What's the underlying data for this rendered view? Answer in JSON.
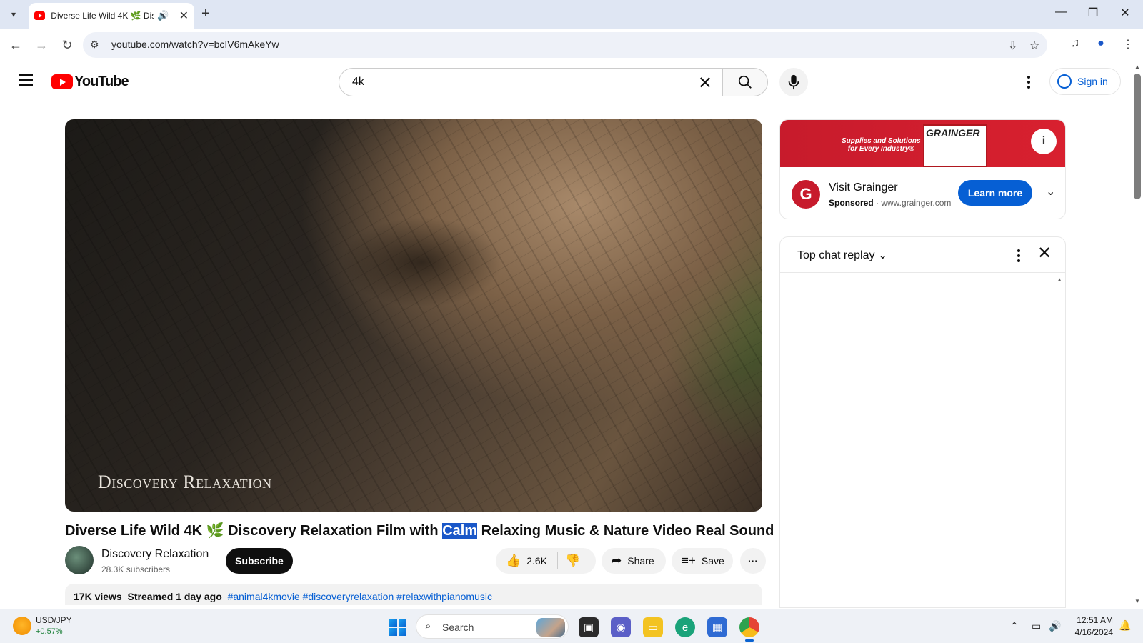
{
  "browser": {
    "tab_title": "Diverse Life Wild 4K 🌿 Dis",
    "url": "youtube.com/watch?v=bcIV6mAkeYw"
  },
  "youtube": {
    "logo_text": "YouTube",
    "search_value": "4k",
    "signin_label": "Sign in"
  },
  "video": {
    "watermark": "Discovery Relaxation",
    "title_before": "Diverse Life Wild 4K 🌿 Discovery Relaxation Film with ",
    "title_highlight": "Calm",
    "title_after": " Relaxing Music & Nature Video Real Sound",
    "channel_name": "Discovery Relaxation",
    "subscribers": "28.3K subscribers",
    "subscribe_label": "Subscribe",
    "likes": "2.6K",
    "share_label": "Share",
    "save_label": "Save",
    "views": "17K views",
    "streamed": "Streamed 1 day ago",
    "hashtags": "#animal4kmovie #discoveryrelaxation #relaxwithpianomusic"
  },
  "ad": {
    "banner_tagline_1": "Supplies and Solutions",
    "banner_tagline_2": "for Every Industry®",
    "banner_brand": "GRAINGER",
    "name": "Visit Grainger",
    "sponsored": "Sponsored",
    "domain": "· www.grainger.com",
    "cta": "Learn more"
  },
  "chat": {
    "title": "Top chat replay"
  },
  "taskbar": {
    "ticker": "USD/JPY",
    "ticker_change": "+0.57%",
    "search_label": "Search",
    "time": "12:51 AM",
    "date": "4/16/2024"
  }
}
